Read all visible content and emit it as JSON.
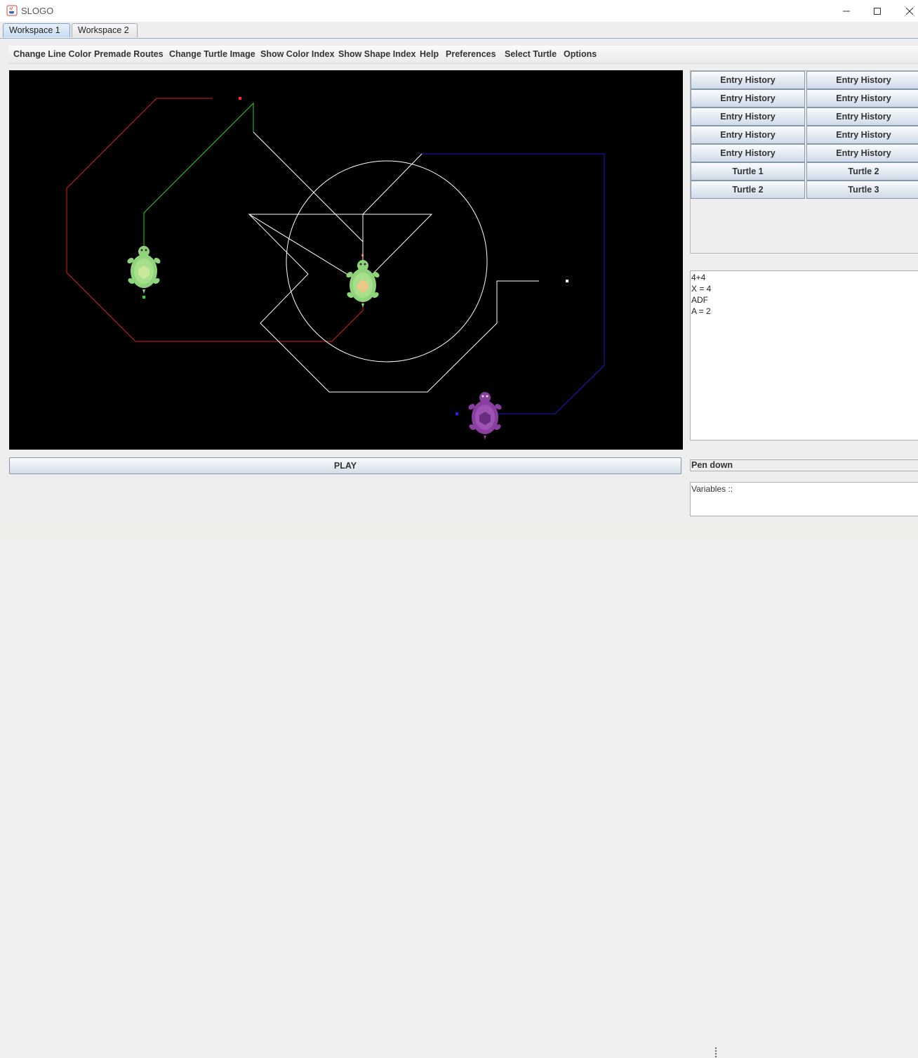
{
  "window": {
    "title": "SLOGO"
  },
  "tabs": [
    {
      "label": "Workspace 1",
      "active": true
    },
    {
      "label": "Workspace 2",
      "active": false
    }
  ],
  "menu": [
    "Change Line Color",
    "Premade Routes",
    "Change Turtle Image",
    "Show Color Index",
    "Show Shape Index",
    "Help",
    "Preferences",
    "Select Turtle",
    "Options"
  ],
  "play_label": "PLAY",
  "buttons": [
    [
      "Entry History",
      "Entry History"
    ],
    [
      "Entry History",
      "Entry History"
    ],
    [
      "Entry History",
      "Entry History"
    ],
    [
      "Entry History",
      "Entry History"
    ],
    [
      "Entry History",
      "Entry History"
    ],
    [
      "Turtle 1",
      "Turtle 2"
    ],
    [
      "Turtle 2",
      "Turtle 3"
    ]
  ],
  "history": [
    "4+4",
    "X = 4",
    "ADF",
    "A = 2"
  ],
  "pen_status": "Pen down",
  "variables_label": "Variables ::",
  "colors": {
    "canvas": "#000000",
    "red_line": "#d42020",
    "green_line": "#33cc33",
    "white_line": "#ffffff",
    "blue_line": "#1a1acc",
    "turtle_green": "#8fd47a",
    "turtle_purple": "#8a3fa0"
  }
}
